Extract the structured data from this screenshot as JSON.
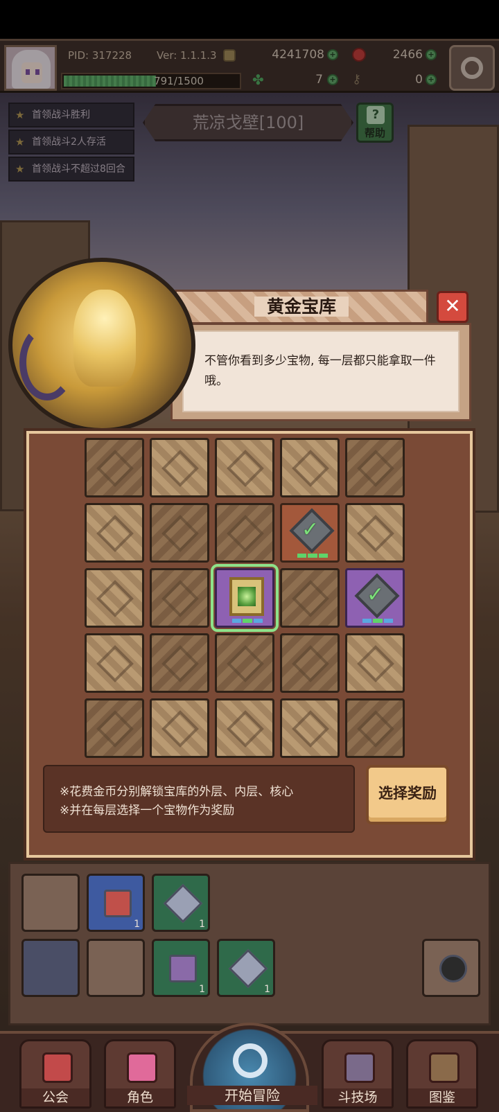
{
  "hud": {
    "pid": "PID: 317228",
    "version": "Ver: 1.1.1.3",
    "gold": "4241708",
    "ruby": "2466",
    "xp": "791/1500",
    "xp_fraction": 0.527,
    "clover": "7",
    "key": "0",
    "plus": "+"
  },
  "quests": [
    "首领战斗胜利",
    "首领战斗2人存活",
    "首领战斗不超过8回合"
  ],
  "stage": {
    "name": "荒凉戈壁[100]",
    "help": "帮助"
  },
  "dialog": {
    "title": "黄金宝库",
    "close": "✕",
    "message": "不管你看到多少宝物, 每一层都只能拿取一件哦。"
  },
  "vault": {
    "notes": [
      "※花费金币分别解锁宝库的外层、内层、核心",
      "※并在每层选择一个宝物作为奖励"
    ],
    "select_button": "选择奖励"
  },
  "inventory": {
    "counts": [
      "1",
      "1",
      "1",
      "1"
    ]
  },
  "nav": {
    "guild": "公会",
    "character": "角色",
    "adventure": "开始冒险",
    "arena": "斗技场",
    "codex": "图鉴"
  },
  "colors": {
    "accent_green": "#8ee28a",
    "close_red": "#d44a3e",
    "button_gold": "#f2c98a"
  }
}
